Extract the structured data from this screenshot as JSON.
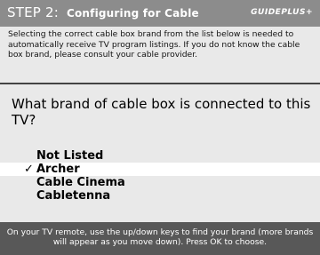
{
  "header": {
    "step": "STEP 2:",
    "title": "Configuring for Cable",
    "logo": "GUIDEPLUS+"
  },
  "intro": {
    "lines": [
      "Selecting the correct cable box brand from the list below is needed to",
      "automatically receive TV program listings.  If you do not know the cable",
      "box brand, please consult your cable provider."
    ]
  },
  "question": "What brand of cable box is connected to this TV?",
  "list": {
    "check_glyph": "✓",
    "items": [
      {
        "label": "Not Listed",
        "selected": false
      },
      {
        "label": "Archer",
        "selected": true
      },
      {
        "label": "Cable Cinema",
        "selected": false
      },
      {
        "label": "Cabletenna",
        "selected": false
      }
    ]
  },
  "footer": {
    "lines": [
      "On your TV remote, use the up/down keys to find your brand (more brands",
      "will appear as you move down).  Press OK to choose."
    ]
  }
}
